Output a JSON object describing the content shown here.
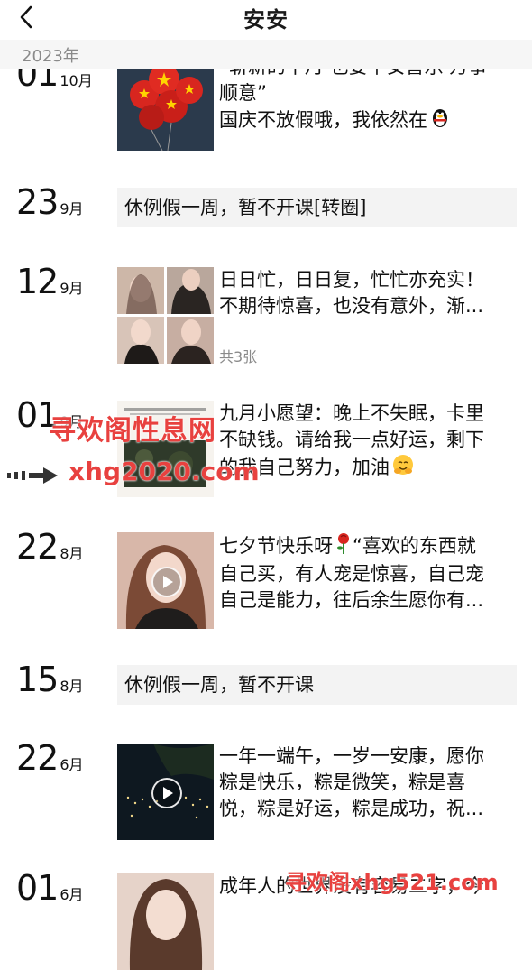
{
  "header": {
    "title": "安安"
  },
  "year_bar": {
    "label": "2023年"
  },
  "posts": [
    {
      "day": "01",
      "month": "10月",
      "lines": [
        "“崭新的十月 也要平安喜乐 万事",
        "顺意”",
        "国庆不放假哦，我依然在"
      ]
    },
    {
      "day": "23",
      "month": "9月",
      "text": "休例假一周，暂不开课[转圈]"
    },
    {
      "day": "12",
      "month": "9月",
      "lines": [
        "日日忙，日日复，忙忙亦充实！",
        "不期待惊喜，也没有意外，渐..."
      ],
      "count": "共3张"
    },
    {
      "day": "01",
      "month": "9月",
      "lines": [
        "九月小愿望：晚上不失眠，卡里",
        "不缺钱。请给我一点好运，剩下",
        "的我自己努力，加油"
      ]
    },
    {
      "day": "22",
      "month": "8月",
      "lines": [
        "七夕节快乐呀",
        "自己买，有人宠是惊喜，自己宠",
        "自己是能力，往后余生愿你有..."
      ],
      "line1_tail": "“喜欢的东西就"
    },
    {
      "day": "15",
      "month": "8月",
      "text": "休例假一周，暂不开课"
    },
    {
      "day": "22",
      "month": "6月",
      "lines": [
        "一年一端午，一岁一安康，愿你",
        "粽是快乐，粽是微笑，粽是喜",
        "悦，粽是好运，粽是成功，祝..."
      ]
    },
    {
      "day": "01",
      "month": "6月",
      "lines": [
        "成年人的世界没有容易二字，今"
      ]
    }
  ],
  "watermarks": {
    "wm1": "寻欢阁性息网",
    "wm2": "xhg2020.com",
    "wm3": "寻欢阁xhg521.com"
  },
  "icons": [
    "back-arrow-icon",
    "balloons-image",
    "play-icon",
    "penguin-emoji-icon",
    "hugging-emoji-icon",
    "rose-emoji-icon"
  ]
}
